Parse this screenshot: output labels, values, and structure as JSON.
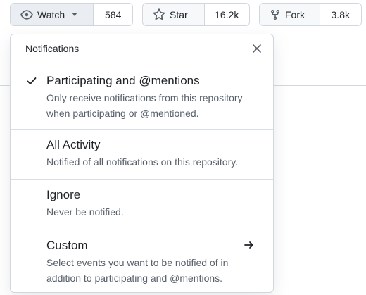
{
  "toolbar": {
    "watch": {
      "label": "Watch",
      "count": "584",
      "icon": "eye-icon"
    },
    "star": {
      "label": "Star",
      "count": "16.2k",
      "icon": "star-icon"
    },
    "fork": {
      "label": "Fork",
      "count": "3.8k",
      "icon": "fork-icon"
    }
  },
  "dropdown": {
    "title": "Notifications",
    "items": [
      {
        "title": "Participating and @mentions",
        "description": "Only receive notifications from this repository when participating or @mentioned.",
        "selected": true
      },
      {
        "title": "All Activity",
        "description": "Notified of all notifications on this repository.",
        "selected": false
      },
      {
        "title": "Ignore",
        "description": "Never be notified.",
        "selected": false
      },
      {
        "title": "Custom",
        "description": "Select events you want to be notified of in addition to participating and @mentions.",
        "selected": false
      }
    ]
  },
  "colors": {
    "border": "#d0d7de",
    "button_bg": "#f6f8fa",
    "text": "#1f2328",
    "muted_text": "#57606a"
  }
}
